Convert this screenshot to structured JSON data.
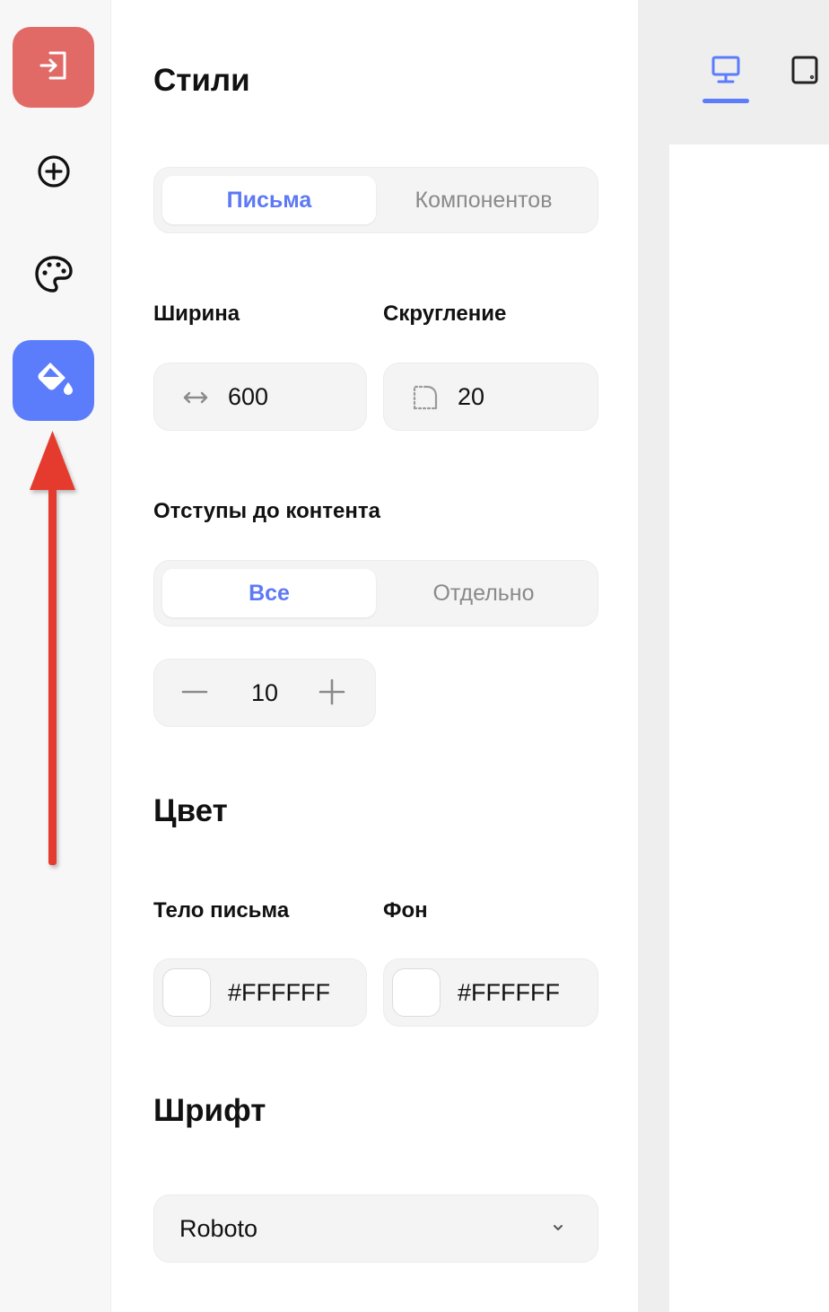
{
  "rail": {
    "items": [
      {
        "name": "exit",
        "icon": "exit-icon",
        "bg": "#e16a66"
      },
      {
        "name": "add-block",
        "icon": "plus-circle-icon"
      },
      {
        "name": "theme",
        "icon": "palette-icon"
      },
      {
        "name": "styles",
        "icon": "paint-bucket-icon",
        "bg": "#5b7cfb",
        "active": true
      }
    ],
    "annotation_arrow_color": "#e53a2f"
  },
  "panel": {
    "title": "Стили",
    "scope_tabs": [
      {
        "label": "Письма",
        "active": true
      },
      {
        "label": "Компонентов",
        "active": false
      }
    ],
    "width": {
      "label": "Ширина",
      "value": "600",
      "icon": "arrows-horizontal-icon"
    },
    "radius": {
      "label": "Скругление",
      "value": "20",
      "icon": "corner-radius-icon"
    },
    "padding": {
      "label": "Отступы до контента",
      "modes": [
        {
          "label": "Все",
          "active": true
        },
        {
          "label": "Отдельно",
          "active": false
        }
      ],
      "value": "10"
    },
    "color": {
      "title": "Цвет",
      "body": {
        "label": "Тело письма",
        "value": "#FFFFFF"
      },
      "background": {
        "label": "Фон",
        "value": "#FFFFFF"
      }
    },
    "font": {
      "title": "Шрифт",
      "selected": "Roboto"
    }
  },
  "preview": {
    "devices": [
      {
        "name": "desktop",
        "icon": "monitor-icon",
        "active": true
      },
      {
        "name": "tablet",
        "icon": "tablet-icon",
        "active": false
      }
    ],
    "accent": "#5b7cfb"
  }
}
